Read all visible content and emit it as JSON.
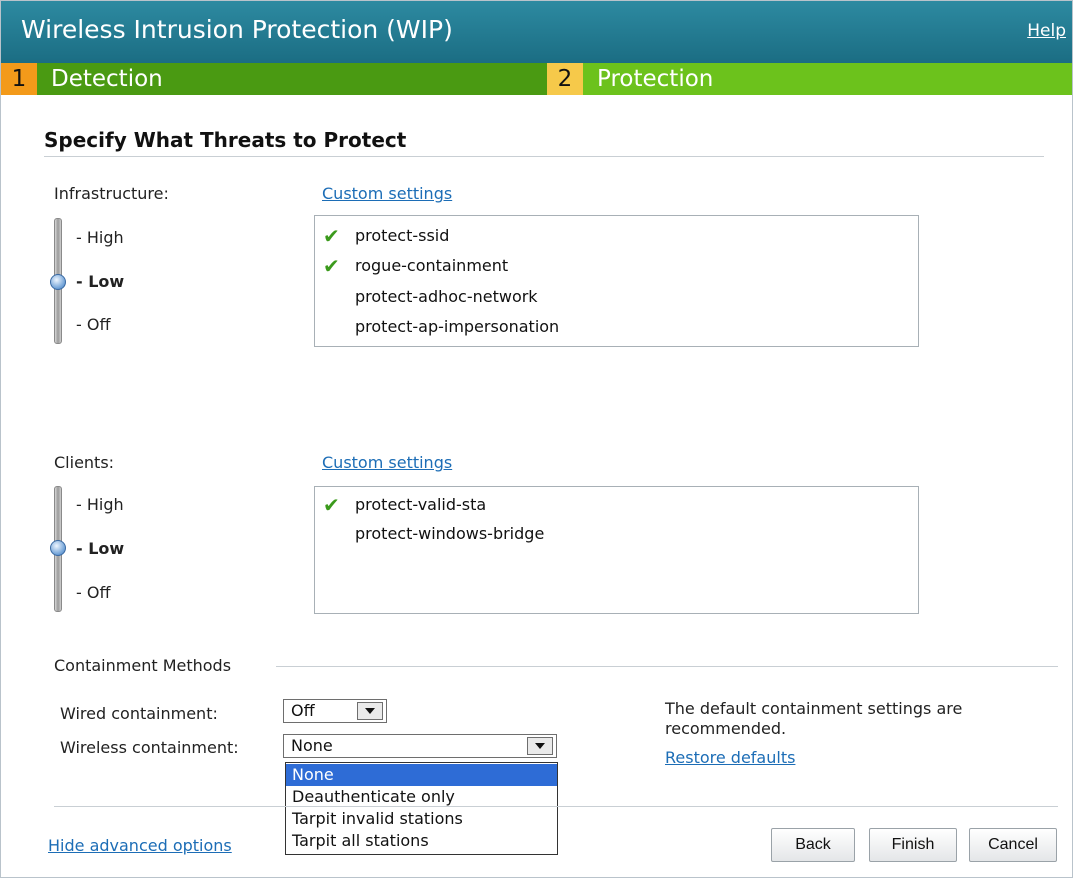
{
  "window": {
    "title": "Wireless Intrusion Protection (WIP)",
    "help_label": "Help"
  },
  "steps": [
    {
      "number": "1",
      "label": "Detection",
      "color": "#4a9a12",
      "num_bg": "#f39a1a"
    },
    {
      "number": "2",
      "label": "Protection",
      "color": "#6cc21c",
      "num_bg": "#f6c94a"
    }
  ],
  "section": {
    "title": "Specify What Threats to Protect"
  },
  "infrastructure": {
    "label": "Infrastructure:",
    "custom_link": "Custom settings",
    "levels": [
      "- High",
      "- Low",
      "- Off"
    ],
    "selected_level": "- Low",
    "threats": [
      {
        "name": "protect-ssid",
        "checked": true
      },
      {
        "name": "rogue-containment",
        "checked": true
      },
      {
        "name": "protect-adhoc-network",
        "checked": false
      },
      {
        "name": "protect-ap-impersonation",
        "checked": false
      }
    ]
  },
  "clients": {
    "label": "Clients:",
    "custom_link": "Custom settings",
    "levels": [
      "- High",
      "- Low",
      "- Off"
    ],
    "selected_level": "- Low",
    "threats": [
      {
        "name": "protect-valid-sta",
        "checked": true
      },
      {
        "name": "protect-windows-bridge",
        "checked": false
      }
    ]
  },
  "containment": {
    "heading": "Containment Methods",
    "wired_label": "Wired containment:",
    "wired_value": "Off",
    "wireless_label": "Wireless containment:",
    "wireless_value": "None",
    "wireless_options": [
      "None",
      "Deauthenticate only",
      "Tarpit invalid stations",
      "Tarpit all stations"
    ],
    "highlighted_option": "None",
    "note": "The default containment settings are recommended.",
    "restore_link": "Restore defaults"
  },
  "footer": {
    "hide_link": "Hide advanced options",
    "back_label": "Back",
    "finish_label": "Finish",
    "cancel_label": "Cancel"
  },
  "icons": {
    "check": "checkmark-icon",
    "dropdown": "chevron-down-icon",
    "slider": "slider-knob"
  }
}
